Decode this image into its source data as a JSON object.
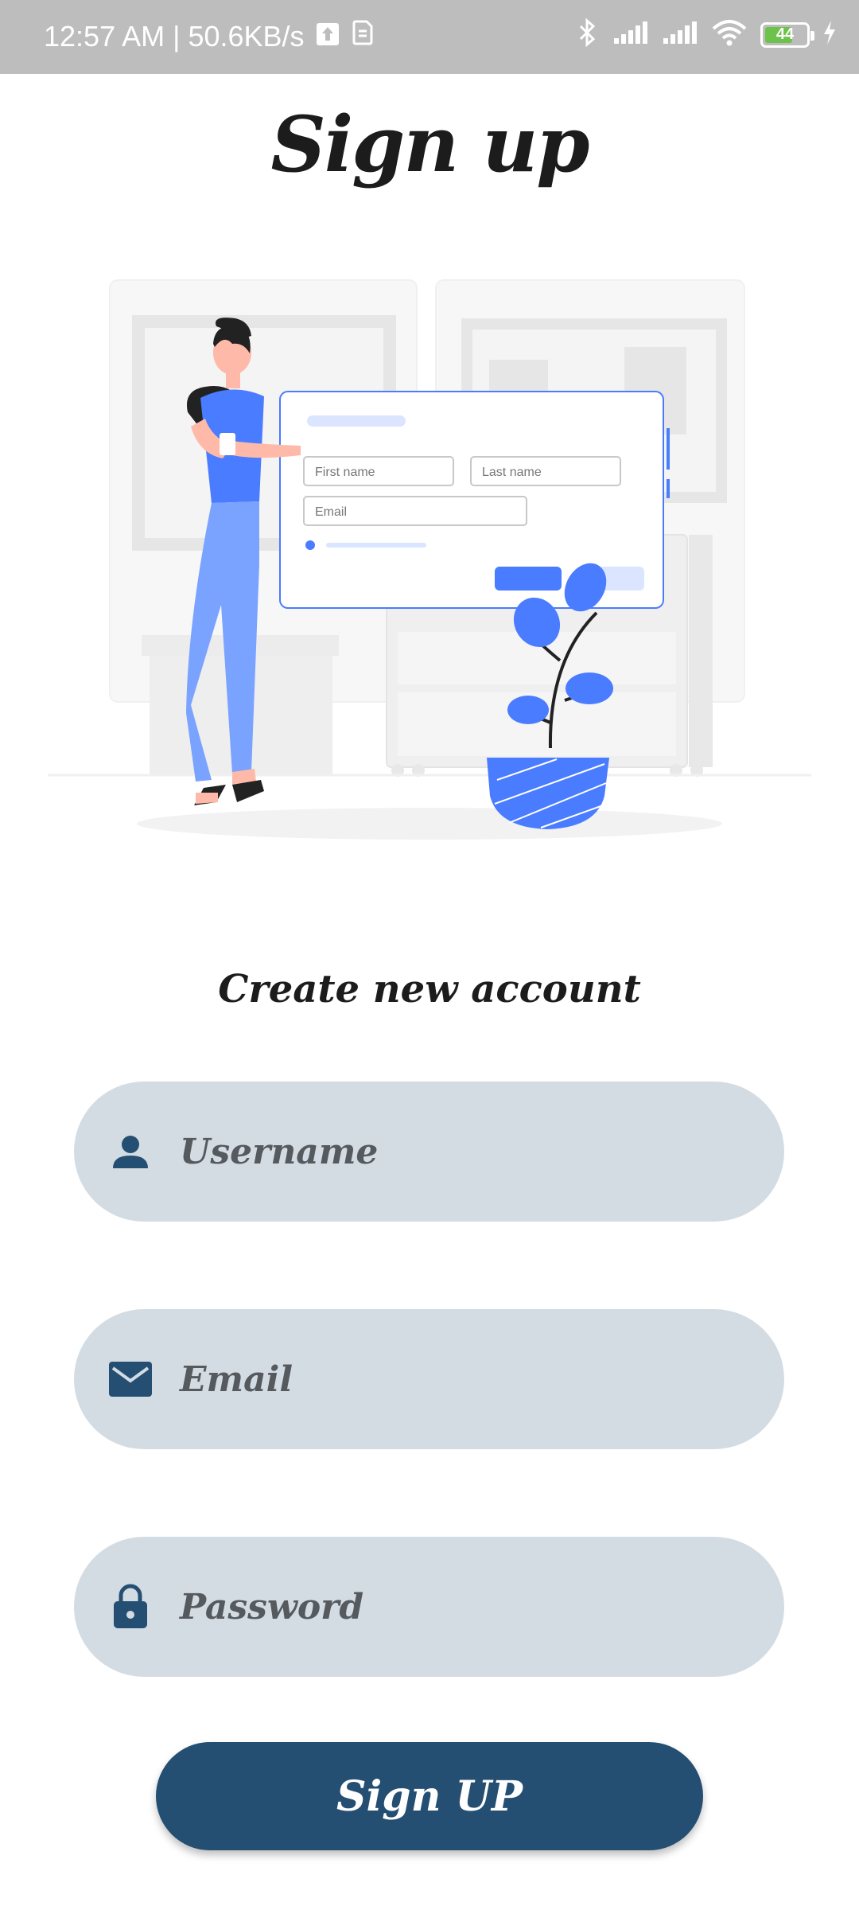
{
  "status_bar": {
    "time_speed": "12:57 AM | 50.6KB/s",
    "battery_level": "44"
  },
  "page": {
    "title": "Sign up",
    "subtitle": "Create new account"
  },
  "illustration": {
    "first_name": "First name",
    "last_name": "Last name",
    "email": "Email"
  },
  "form": {
    "username_placeholder": "Username",
    "email_placeholder": "Email",
    "password_placeholder": "Password",
    "submit_label": "Sign UP"
  },
  "colors": {
    "accent": "#244f72",
    "field_bg": "#d4dce3",
    "illustration_blue": "#4a7cff"
  }
}
